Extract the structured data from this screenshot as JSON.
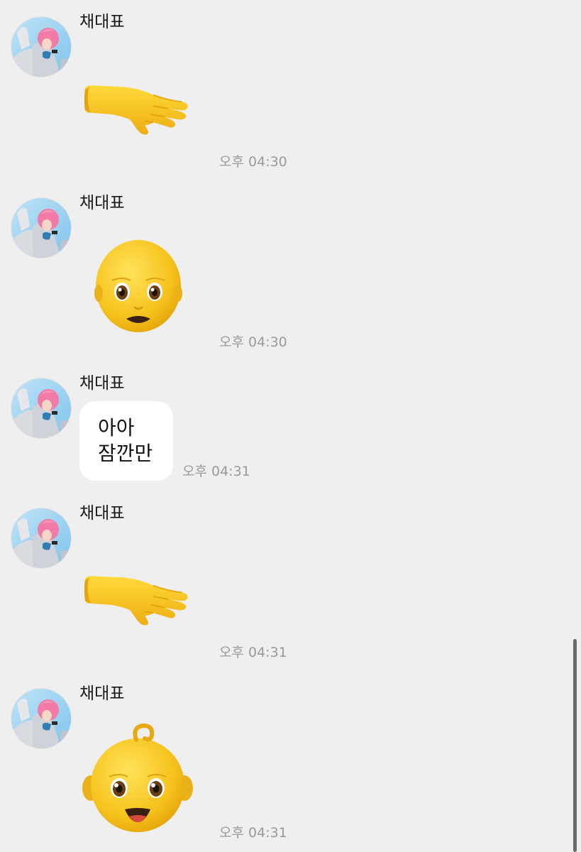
{
  "messages": [
    {
      "sender": "채대표",
      "emoji": "hand-reaching-emoji",
      "time": "오후 04:30"
    },
    {
      "sender": "채대표",
      "emoji": "bald-face-emoji",
      "time": "오후 04:30"
    },
    {
      "sender": "채대표",
      "lines": [
        "아아",
        "잠깐만"
      ],
      "time": "오후 04:31"
    },
    {
      "sender": "채대표",
      "emoji": "hand-reaching-emoji",
      "time": "오후 04:31"
    },
    {
      "sender": "채대표",
      "emoji": "baby-face-emoji",
      "time": "오후 04:31"
    }
  ],
  "colors": {
    "background": "#efefef",
    "bubble": "#ffffff",
    "timestamp": "#9a9a9a",
    "emoji_yellow": "#f8c51c"
  }
}
